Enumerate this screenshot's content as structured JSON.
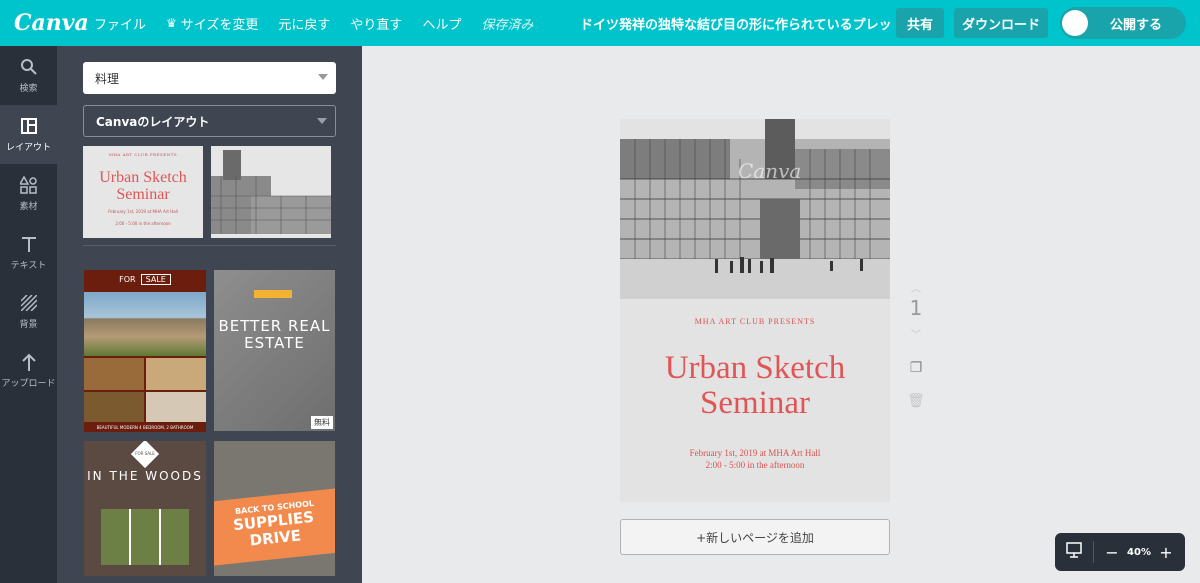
{
  "topbar": {
    "logo": "Canva",
    "menu": [
      {
        "label": "ファイル"
      },
      {
        "label": "サイズを変更"
      },
      {
        "label": "元に戻す"
      },
      {
        "label": "やり直す"
      },
      {
        "label": "ヘルプ"
      }
    ],
    "saved_status": "保存済み",
    "doc_title": "ドイツ発祥の独特な結び目の形に作られているプレッツ...",
    "share_label": "共有",
    "download_label": "ダウンロード",
    "publish_label": "公開する"
  },
  "rail": {
    "items": [
      {
        "label": "検索",
        "icon": "search-icon"
      },
      {
        "label": "レイアウト",
        "icon": "layout-icon"
      },
      {
        "label": "素材",
        "icon": "elements-icon"
      },
      {
        "label": "テキスト",
        "icon": "text-icon"
      },
      {
        "label": "背景",
        "icon": "background-icon"
      },
      {
        "label": "アップロード",
        "icon": "upload-icon"
      }
    ]
  },
  "panel": {
    "search_value": "料理",
    "layout_select": "Canvaのレイアウト",
    "templates": [
      {
        "small": "MHA ART CLUB PRESENTS",
        "title": "Urban Sketch Seminar",
        "line1": "February 1st, 2019 at MHA Art Hall",
        "line2": "2:00 - 5:00 in the afternoon"
      },
      {
        "head": "FOR",
        "tag": "SALE",
        "footer": "BEAUTIFUL MODERN 4 BEDROOM, 2 BATHROOM"
      },
      {
        "title": "BETTER REAL ESTATE",
        "badge": "無料"
      },
      {
        "tag": "FOR SALE",
        "title": "IN THE WOODS"
      },
      {
        "line1": "BACK TO SCHOOL",
        "line2": "SUPPLIES DRIVE"
      }
    ]
  },
  "canvas": {
    "watermark": "Canva",
    "subtitle": "MHA ART CLUB PRESENTS",
    "title_line1": "Urban Sketch",
    "title_line2": "Seminar",
    "date": "February 1st, 2019 at MHA Art Hall",
    "time": "2:00 - 5:00 in the afternoon",
    "page_number": "1",
    "add_page_label": "+新しいページを追加"
  },
  "zoom": {
    "value": "40%"
  },
  "colors": {
    "topbar": "#00c4cc",
    "rail": "#293039",
    "panel": "#3f4652",
    "accent_red": "#e05656"
  }
}
